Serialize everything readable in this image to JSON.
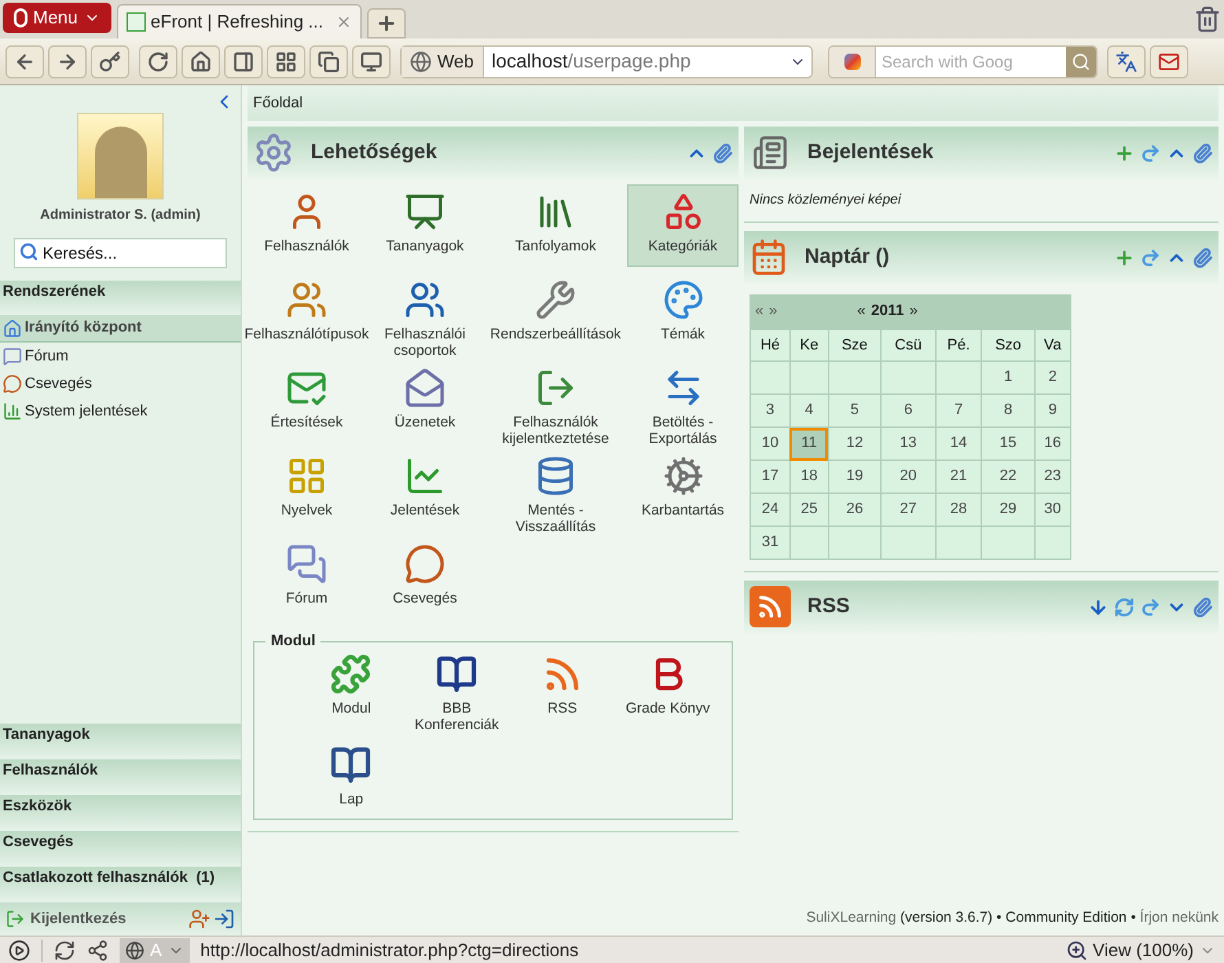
{
  "browser": {
    "menu": "Menu",
    "tabs": [
      {
        "title": "eFront | Refreshing ...",
        "selected": true
      }
    ],
    "address": {
      "search_engine": "Web",
      "host": "localhost",
      "path": "/userpage.php"
    },
    "search": {
      "placeholder": "Search with Goog"
    }
  },
  "sidebar": {
    "user": "Administrator S. (admin)",
    "search": {
      "placeholder": "Keresés..."
    },
    "section": "Rendszerének",
    "items": [
      {
        "label": "Irányító központ",
        "selected": true
      },
      {
        "label": "Fórum",
        "selected": false
      },
      {
        "label": "Csevegés",
        "selected": false
      },
      {
        "label": "System jelentések",
        "selected": false
      }
    ],
    "groups": [
      "Tananyagok",
      "Felhasználók",
      "Eszközök",
      "Csevegés",
      "Csatlakozott felhasználók  (1)"
    ],
    "logout": "Kijelentkezés"
  },
  "breadcrumb": "Főoldal",
  "options": {
    "title": "Lehetőségek",
    "items": [
      {
        "label": "Felhasználók",
        "selected": false
      },
      {
        "label": "Tananyagok",
        "selected": false
      },
      {
        "label": "Tanfolyamok",
        "selected": false
      },
      {
        "label": "Kategóriák",
        "selected": true
      },
      {
        "label": "Felhasználótípusok",
        "selected": false
      },
      {
        "label": "Felhasználói csoportok",
        "selected": false
      },
      {
        "label": "Rendszerbeállítások",
        "selected": false
      },
      {
        "label": "Témák",
        "selected": false
      },
      {
        "label": "Értesítések",
        "selected": false
      },
      {
        "label": "Üzenetek",
        "selected": false
      },
      {
        "label": "Felhasználók kijelentkeztetése",
        "selected": false
      },
      {
        "label": "Betöltés - Exportálás",
        "selected": false
      },
      {
        "label": "Nyelvek",
        "selected": false
      },
      {
        "label": "Jelentések",
        "selected": false
      },
      {
        "label": "Mentés - Visszaállítás",
        "selected": false
      },
      {
        "label": "Karbantartás",
        "selected": false
      },
      {
        "label": "Fórum",
        "selected": false
      },
      {
        "label": "Csevegés",
        "selected": false
      }
    ],
    "module_group": {
      "title": "Modul",
      "items": [
        "Modul",
        "BBB Konferenciák",
        "RSS",
        "Grade Könyv",
        "Lap"
      ]
    }
  },
  "announcements": {
    "title": "Bejelentések",
    "text": "Nincs közleményei képei"
  },
  "calendar": {
    "title": "Naptár ()",
    "month_prev": "«",
    "month_next": "»",
    "year_prev": "«",
    "year": "2011",
    "year_next": "»",
    "weekdays": [
      "Hé",
      "Ke",
      "Sze",
      "Csü",
      "Pé.",
      "Szo",
      "Va"
    ],
    "weeks": [
      [
        {
          "kind": "blank"
        },
        {
          "kind": "blank"
        },
        {
          "kind": "blank"
        },
        {
          "kind": "blank"
        },
        {
          "kind": "blank"
        },
        {
          "kind": "day",
          "day": "1",
          "selected": false
        },
        {
          "kind": "day",
          "day": "2",
          "selected": false
        }
      ],
      [
        {
          "day": "3",
          "selected": false
        },
        {
          "day": "4",
          "selected": false
        },
        {
          "day": "5",
          "selected": false
        },
        {
          "day": "6",
          "selected": false
        },
        {
          "day": "7",
          "selected": false
        },
        {
          "day": "8",
          "selected": false
        },
        {
          "day": "9",
          "selected": false
        }
      ],
      [
        {
          "day": "10",
          "selected": false
        },
        {
          "day": "11",
          "selected": true
        },
        {
          "day": "12",
          "selected": false
        },
        {
          "day": "13",
          "selected": false
        },
        {
          "day": "14",
          "selected": false
        },
        {
          "day": "15",
          "selected": false
        },
        {
          "day": "16",
          "selected": false
        }
      ],
      [
        {
          "day": "17",
          "selected": false
        },
        {
          "day": "18",
          "selected": false
        },
        {
          "day": "19",
          "selected": false
        },
        {
          "day": "20",
          "selected": false
        },
        {
          "day": "21",
          "selected": false
        },
        {
          "day": "22",
          "selected": false
        },
        {
          "day": "23",
          "selected": false
        }
      ],
      [
        {
          "day": "24",
          "selected": false
        },
        {
          "day": "25",
          "selected": false
        },
        {
          "day": "26",
          "selected": false
        },
        {
          "day": "27",
          "selected": false
        },
        {
          "day": "28",
          "selected": false
        },
        {
          "day": "29",
          "selected": false
        },
        {
          "day": "30",
          "selected": false
        }
      ],
      [
        {
          "kind": "day",
          "day": "31",
          "selected": false
        },
        {
          "kind": "blank"
        },
        {
          "kind": "blank"
        },
        {
          "kind": "blank"
        },
        {
          "kind": "blank"
        },
        {
          "kind": "blank"
        },
        {
          "kind": "blank"
        }
      ]
    ]
  },
  "rss": {
    "title": "RSS"
  },
  "footer": {
    "brand": "SuliXLearning",
    "version": "(version 3.6.7) • Community Edition •",
    "contact": "Írjon nekünk"
  },
  "status_bar": {
    "url": "http://localhost/administrator.php?ctg=directions",
    "zoom": "View (100%)",
    "mode": "A"
  }
}
